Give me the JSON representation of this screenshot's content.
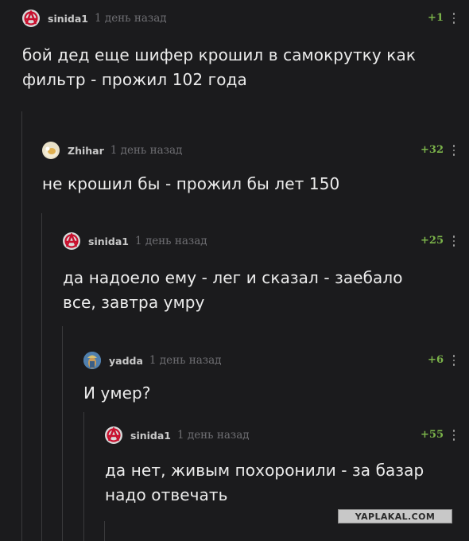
{
  "comments": [
    {
      "username": "sinida1",
      "time": "1 день назад",
      "rating": "+1",
      "text": "бой дед еще шифер крошил в самокрутку как\nфильтр - прожил 102 года",
      "avatar_icon": "anarchy-icon"
    },
    {
      "username": "Zhihar",
      "time": "1 день назад",
      "rating": "+32",
      "text": "не крошил бы - прожил бы лет 150",
      "avatar_icon": "cat-avatar-icon"
    },
    {
      "username": "sinida1",
      "time": "1 день назад",
      "rating": "+25",
      "text": "да надоело ему - лег и сказал - заебало\nвсе, завтра умру",
      "avatar_icon": "anarchy-icon"
    },
    {
      "username": "yadda",
      "time": "1 день назад",
      "rating": "+6",
      "text": "И умер?",
      "avatar_icon": "warrior-avatar-icon"
    },
    {
      "username": "sinida1",
      "time": "1 день назад",
      "rating": "+55",
      "text": "да нет, живым похоронили - за базар\nнадо отвечать",
      "avatar_icon": "anarchy-icon"
    }
  ],
  "watermark": "YAPLAKAL.COM",
  "colors": {
    "background": "#1b1b1d",
    "rating": "#7bb34a",
    "anarchy": "#c8102e"
  }
}
